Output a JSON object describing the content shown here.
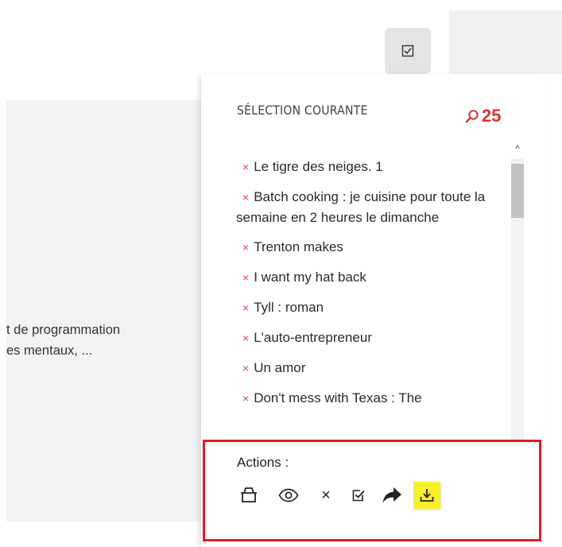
{
  "background": {
    "lines": [
      "t de programmation",
      "es mentaux, ..."
    ]
  },
  "toggle": {
    "icon": "checkbox-icon"
  },
  "panel": {
    "title": "SÉLECTION COURANTE",
    "count": "25",
    "count_icon": "search-icon",
    "accent_color": "#e03030",
    "items": [
      {
        "remove": "×",
        "label": "Le tigre des neiges. 1"
      },
      {
        "remove": "×",
        "label": "Batch cooking : je cuisine pour toute la semaine en 2 heures le dimanche"
      },
      {
        "remove": "×",
        "label": "Trenton makes"
      },
      {
        "remove": "×",
        "label": "I want my hat back"
      },
      {
        "remove": "×",
        "label": "Tyll : roman"
      },
      {
        "remove": "×",
        "label": "L'auto-entrepreneur"
      },
      {
        "remove": "×",
        "label": "Un amor"
      },
      {
        "remove": "×",
        "label": "Don't mess with Texas : The"
      }
    ],
    "scroll": {
      "up": "^",
      "down": "v"
    }
  },
  "actions": {
    "label": "Actions :",
    "highlight_color": "#e31b1b",
    "buttons": [
      {
        "name": "basket-icon"
      },
      {
        "name": "eye-icon"
      },
      {
        "name": "close-icon",
        "glyph": "×"
      },
      {
        "name": "checkbox-icon"
      },
      {
        "name": "share-arrow-icon"
      },
      {
        "name": "download-icon",
        "highlight": "#f7f02b"
      }
    ]
  }
}
